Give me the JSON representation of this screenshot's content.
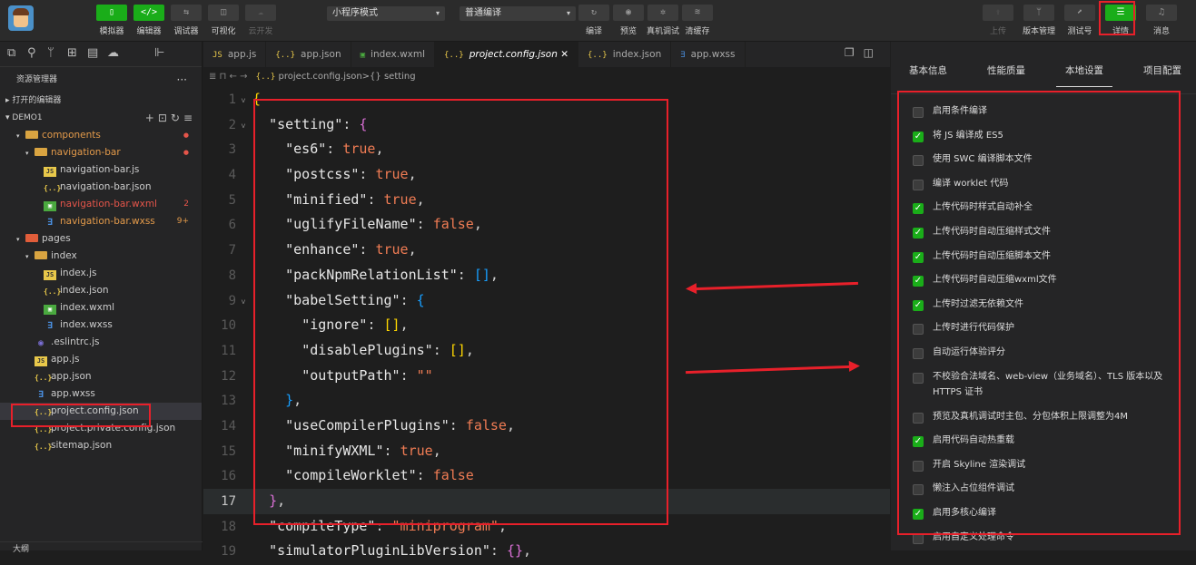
{
  "toolbar": {
    "left_buttons": [
      {
        "label": "模拟器",
        "icon": "phone-icon",
        "glyph": "▯",
        "on": true
      },
      {
        "label": "编辑器",
        "icon": "code-icon",
        "glyph": "</>",
        "on": true
      },
      {
        "label": "调试器",
        "icon": "debug-icon",
        "glyph": "⇆",
        "on": false
      },
      {
        "label": "可视化",
        "icon": "visual-icon",
        "glyph": "◫",
        "on": false
      },
      {
        "label": "云开发",
        "icon": "cloud-icon",
        "glyph": "☁",
        "on": false,
        "disabled": true
      }
    ],
    "mode_select": "小程序模式",
    "compile_select": "普通编译",
    "mid_buttons": [
      {
        "label": "编译",
        "icon": "refresh-icon",
        "glyph": "↻"
      },
      {
        "label": "预览",
        "icon": "eye-icon",
        "glyph": "◉"
      },
      {
        "label": "真机调试",
        "icon": "bug-icon",
        "glyph": "✲"
      },
      {
        "label": "清缓存",
        "icon": "layers-icon",
        "glyph": "≋"
      }
    ],
    "right_buttons": [
      {
        "label": "上传",
        "icon": "upload-icon",
        "glyph": "⇪",
        "disabled": true
      },
      {
        "label": "版本管理",
        "icon": "branch-icon",
        "glyph": "ᛘ"
      },
      {
        "label": "测试号",
        "icon": "test-icon",
        "glyph": "⬈"
      },
      {
        "label": "详情",
        "icon": "menu-icon",
        "glyph": "☰",
        "on": true
      },
      {
        "label": "消息",
        "icon": "bell-icon",
        "glyph": "♫"
      }
    ]
  },
  "sidebar": {
    "title": "资源管理器",
    "more": "···",
    "open_editors": "打开的编辑器",
    "project": "DEMO1",
    "tree": [
      {
        "depth": 1,
        "arrow": "▾",
        "type": "folder",
        "name": "components",
        "color": "orange",
        "dot": "●"
      },
      {
        "depth": 2,
        "arrow": "▾",
        "type": "folder",
        "name": "navigation-bar",
        "color": "orange",
        "dot": "●"
      },
      {
        "depth": 3,
        "type": "js",
        "name": "navigation-bar.js"
      },
      {
        "depth": 3,
        "type": "json",
        "name": "navigation-bar.json"
      },
      {
        "depth": 3,
        "type": "wxml",
        "name": "navigation-bar.wxml",
        "color": "red",
        "badge": "2"
      },
      {
        "depth": 3,
        "type": "wxss",
        "name": "navigation-bar.wxss",
        "color": "orange",
        "badge": "9+"
      },
      {
        "depth": 1,
        "arrow": "▾",
        "type": "folder-pages",
        "name": "pages"
      },
      {
        "depth": 2,
        "arrow": "▾",
        "type": "folder",
        "name": "index"
      },
      {
        "depth": 3,
        "type": "js",
        "name": "index.js"
      },
      {
        "depth": 3,
        "type": "json",
        "name": "index.json"
      },
      {
        "depth": 3,
        "type": "wxml",
        "name": "index.wxml"
      },
      {
        "depth": 3,
        "type": "wxss",
        "name": "index.wxss"
      },
      {
        "depth": 2,
        "type": "eslint",
        "name": ".eslintrc.js"
      },
      {
        "depth": 2,
        "type": "js",
        "name": "app.js"
      },
      {
        "depth": 2,
        "type": "json",
        "name": "app.json"
      },
      {
        "depth": 2,
        "type": "wxss",
        "name": "app.wxss"
      },
      {
        "depth": 2,
        "type": "json",
        "name": "project.config.json",
        "selected": true
      },
      {
        "depth": 2,
        "type": "json",
        "name": "project.private.config.json"
      },
      {
        "depth": 2,
        "type": "json",
        "name": "sitemap.json"
      }
    ],
    "bottom": "大纲"
  },
  "editor": {
    "tabs": [
      {
        "icon": "js",
        "glyph": "JS",
        "name": "app.js"
      },
      {
        "icon": "json",
        "glyph": "{..}",
        "name": "app.json"
      },
      {
        "icon": "wxml",
        "glyph": "▣",
        "name": "index.wxml"
      },
      {
        "icon": "json",
        "glyph": "{..}",
        "name": "project.config.json",
        "active": true,
        "close": "✕"
      },
      {
        "icon": "json",
        "glyph": "{..}",
        "name": "index.json"
      },
      {
        "icon": "wxss",
        "glyph": "∃",
        "name": "app.wxss"
      }
    ],
    "breadcrumb": [
      "project.config.json",
      ">",
      "{} setting"
    ],
    "lines": [
      {
        "n": "1",
        "fold": "˅",
        "html": "<span class='br1'>{</span>"
      },
      {
        "n": "2",
        "fold": "˅",
        "html": "  <span class='ky'>\"setting\"</span><span class='wh'>: </span><span class='br2'>{</span>"
      },
      {
        "n": "3",
        "html": "    <span class='ky'>\"es6\"</span><span class='wh'>: </span><span class='kv'>true</span><span class='wh'>,</span>"
      },
      {
        "n": "4",
        "html": "    <span class='ky'>\"postcss\"</span><span class='wh'>: </span><span class='kv'>true</span><span class='wh'>,</span>"
      },
      {
        "n": "5",
        "html": "    <span class='ky'>\"minified\"</span><span class='wh'>: </span><span class='kv'>true</span><span class='wh'>,</span>"
      },
      {
        "n": "6",
        "html": "    <span class='ky'>\"uglifyFileName\"</span><span class='wh'>: </span><span class='kv'>false</span><span class='wh'>,</span>"
      },
      {
        "n": "7",
        "html": "    <span class='ky'>\"enhance\"</span><span class='wh'>: </span><span class='kv'>true</span><span class='wh'>,</span>"
      },
      {
        "n": "8",
        "html": "    <span class='ky'>\"packNpmRelationList\"</span><span class='wh'>: </span><span class='br3'>[]</span><span class='wh'>,</span>"
      },
      {
        "n": "9",
        "fold": "˅",
        "html": "    <span class='ky'>\"babelSetting\"</span><span class='wh'>: </span><span class='br3'>{</span>"
      },
      {
        "n": "10",
        "html": "      <span class='ky'>\"ignore\"</span><span class='wh'>: </span><span class='br1'>[]</span><span class='wh'>,</span>"
      },
      {
        "n": "11",
        "html": "      <span class='ky'>\"disablePlugins\"</span><span class='wh'>: </span><span class='br1'>[]</span><span class='wh'>,</span>"
      },
      {
        "n": "12",
        "html": "      <span class='ky'>\"outputPath\"</span><span class='wh'>: </span><span class='str'>\"\"</span>"
      },
      {
        "n": "13",
        "html": "    <span class='br3'>}</span><span class='wh'>,</span>"
      },
      {
        "n": "14",
        "html": "    <span class='ky'>\"useCompilerPlugins\"</span><span class='wh'>: </span><span class='kv'>false</span><span class='wh'>,</span>"
      },
      {
        "n": "15",
        "html": "    <span class='ky'>\"minifyWXML\"</span><span class='wh'>: </span><span class='kv'>true</span><span class='wh'>,</span>"
      },
      {
        "n": "16",
        "html": "    <span class='ky'>\"compileWorklet\"</span><span class='wh'>: </span><span class='kv'>false</span>"
      },
      {
        "n": "17",
        "cur": true,
        "html": "  <span class='br2'>}</span><span class='wh'>,</span>"
      },
      {
        "n": "18",
        "html": "  <span class='ky'>\"compileType\"</span><span class='wh'>: </span><span class='str'>\"miniprogram\"</span><span class='wh'>,</span>"
      },
      {
        "n": "19",
        "html": "  <span class='ky'>\"simulatorPluginLibVersion\"</span><span class='wh'>: </span><span class='br2'>{}</span><span class='wh'>,</span>"
      }
    ]
  },
  "details": {
    "tabs": [
      "基本信息",
      "性能质量",
      "本地设置",
      "项目配置"
    ],
    "active_tab": "本地设置",
    "options": [
      {
        "label": "启用条件编译",
        "checked": false
      },
      {
        "label": "将 JS 编译成 ES5",
        "checked": true
      },
      {
        "label": "使用 SWC 编译脚本文件",
        "checked": false
      },
      {
        "label": "编译 worklet 代码",
        "checked": false
      },
      {
        "label": "上传代码时样式自动补全",
        "checked": true
      },
      {
        "label": "上传代码时自动压缩样式文件",
        "checked": true
      },
      {
        "label": "上传代码时自动压缩脚本文件",
        "checked": true
      },
      {
        "label": "上传代码时自动压缩wxml文件",
        "checked": true
      },
      {
        "label": "上传时过滤无依赖文件",
        "checked": true
      },
      {
        "label": "上传时进行代码保护",
        "checked": false
      },
      {
        "label": "自动运行体验评分",
        "checked": false
      },
      {
        "label": "不校验合法域名、web-view（业务域名）、TLS 版本以及 HTTPS 证书",
        "checked": false,
        "two": true
      },
      {
        "label": "预览及真机调试时主包、分包体积上限调整为4M",
        "checked": false
      },
      {
        "label": "启用代码自动热重载",
        "checked": true
      },
      {
        "label": "开启 Skyline 渲染调试",
        "checked": false
      },
      {
        "label": "懒注入占位组件调试",
        "checked": false
      },
      {
        "label": "启用多核心编译",
        "checked": true
      },
      {
        "label": "启用自定义处理命令",
        "checked": false
      }
    ]
  },
  "colors": {
    "accent": "#1aad19",
    "highlight": "#e8202a"
  }
}
